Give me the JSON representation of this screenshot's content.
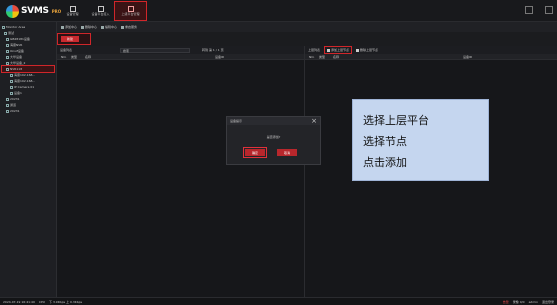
{
  "app": {
    "logo_text": "SVMS",
    "logo_badge": "PRO",
    "nav_tabs": [
      {
        "label": "设备管理"
      },
      {
        "label": "设备平台接入"
      },
      {
        "label": "上级平台管理"
      }
    ]
  },
  "tree": {
    "items": [
      "Monitor Area",
      "测试",
      "GB28181设备",
      "海康NVR",
      "Onvif设备",
      "大华设备",
      "大华设备_2",
      "NVR118",
      "海康192.168...",
      "海康192.168...",
      "IP Camera 01",
      "设备1",
      "20231",
      "通道",
      "20231"
    ]
  },
  "toolbar": {
    "items": [
      "添加中心",
      "删除中心",
      "编辑中心",
      "重启服务"
    ]
  },
  "add_button": {
    "label": "新建"
  },
  "left_panel": {
    "filter_label": "设备列表",
    "search_placeholder": "搜索",
    "paging": "转到 第 1 / 1 页",
    "columns": [
      "NO.",
      "类型",
      "名称",
      "设备ID"
    ]
  },
  "right_panel": {
    "label": "上层列表",
    "add_upper_label": "添加上层节点",
    "delete_upper_label": "删除上层节点",
    "columns": [
      "NO.",
      "类型",
      "名称",
      "设备ID"
    ]
  },
  "dialog": {
    "title": "设备提示",
    "message": "是否添加?",
    "ok_label": "确定",
    "cancel_label": "取消"
  },
  "note": {
    "lines": [
      "选择上层平台",
      "选择节点",
      "点击添加"
    ]
  },
  "status": {
    "time": "2024-07-19 16:41:40",
    "cpu": "CPU",
    "net": "下 3.9Kbps 上 0.3Kbps",
    "right_items": [
      "告警",
      "录像 0/0",
      "admin",
      "退出登录"
    ]
  }
}
